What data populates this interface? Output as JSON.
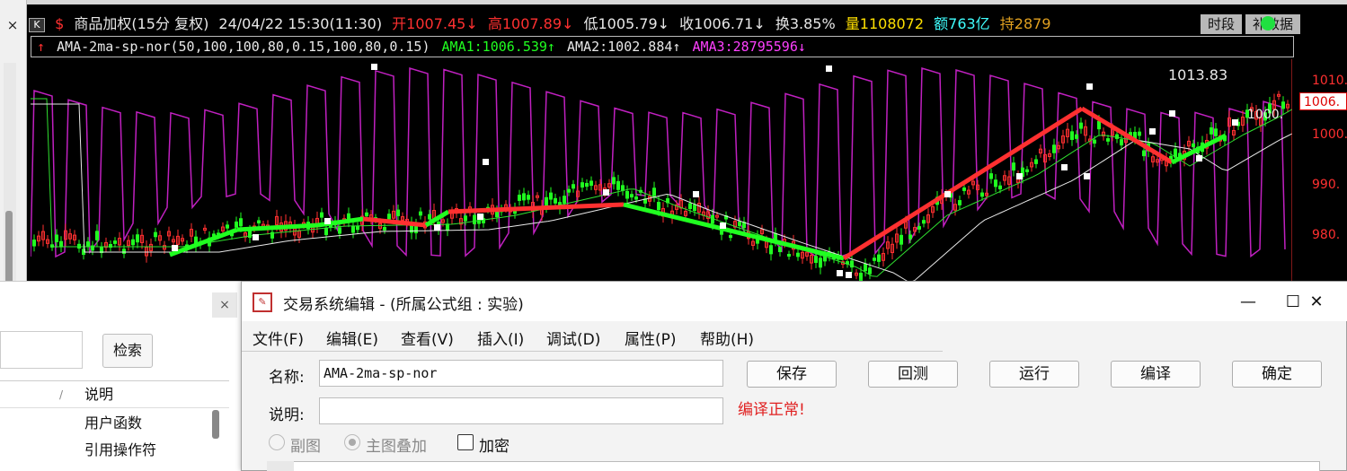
{
  "chart": {
    "period_badge": "K",
    "title": "商品加权(15分 复权)",
    "datetime": "24/04/22 15:30(11:30)",
    "open": "开1007.45↓",
    "high": "高1007.89↓",
    "low": "低1005.79↓",
    "close": "收1006.71↓",
    "turnover": "换3.85%",
    "volume": "量1108072",
    "amount": "额763亿",
    "holdings": "持2879",
    "btn_timeframe": "时段",
    "btn_supplement": "补数据",
    "formula_arrow": "↑",
    "formula_name": "AMA-2ma-sp-nor(50,100,100,80,0.15,100,80,0.15)",
    "ama1": "AMA1:1006.539↑",
    "ama2": "AMA2:1002.884↑",
    "ama3": "AMA3:28795596↓",
    "last_price": "1006.",
    "high_annotation": "1013.83",
    "mid_annotation": "1000.",
    "price_labels": [
      "1010.",
      "1000.",
      "990.",
      "980."
    ],
    "colors": {
      "up": "#ff3030",
      "down": "#20ff20",
      "ama": "#c020c0",
      "bg": "#000000"
    }
  },
  "left_panel": {
    "close_label": "×",
    "search_button": "检索",
    "col_sep": "/",
    "col_desc": "说明",
    "rows": [
      "用户函数",
      "引用操作符"
    ]
  },
  "left_strip": {
    "close_label": "×"
  },
  "dialog": {
    "title": "交易系统编辑 - (所属公式组 : 实验)",
    "minimize": "—",
    "maximize": "☐",
    "close": "✕",
    "menu": [
      "文件(F)",
      "编辑(E)",
      "查看(V)",
      "插入(I)",
      "调试(D)",
      "属性(P)",
      "帮助(H)"
    ],
    "name_label": "名称:",
    "name_value": "AMA-2ma-sp-nor",
    "desc_label": "说明:",
    "desc_value": "",
    "buttons": {
      "save": "保存",
      "backtest": "回测",
      "run": "运行",
      "compile": "编译",
      "ok": "确定"
    },
    "compile_status": "编译正常!",
    "radio_sub": "副图",
    "radio_main": "主图叠加",
    "checkbox_encrypt": "加密"
  }
}
